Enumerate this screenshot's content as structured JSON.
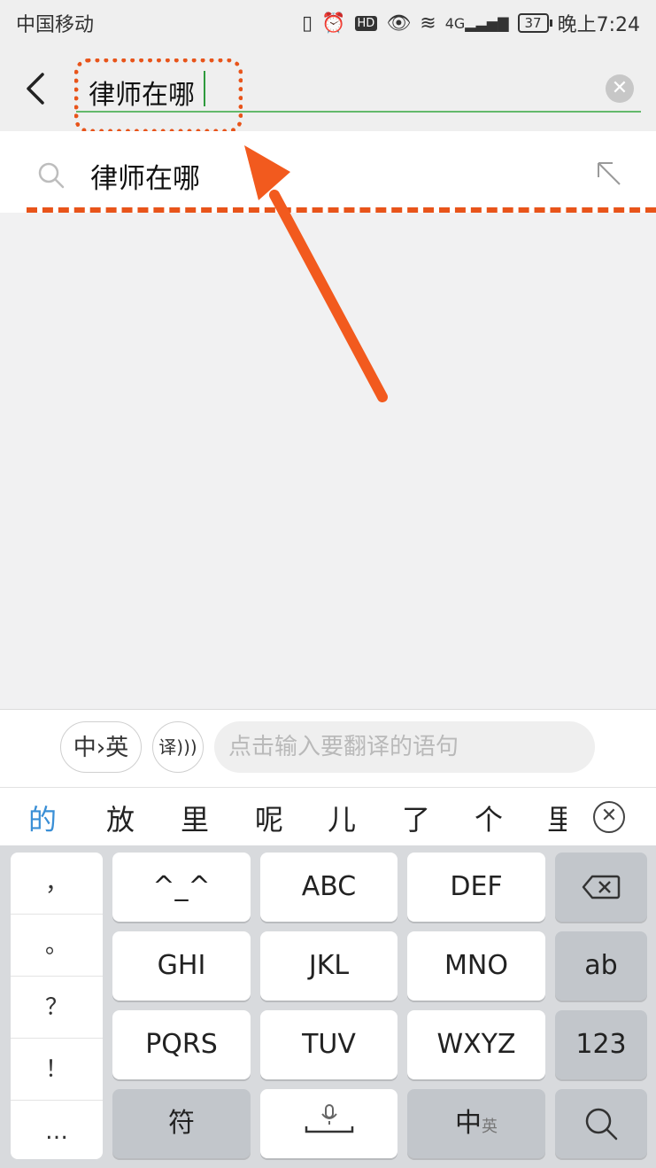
{
  "status_bar": {
    "carrier": "中国移动",
    "icons": [
      "vibrate-icon",
      "alarm-icon",
      "hd-icon",
      "eye-icon",
      "wifi-icon",
      "signal-4g-icon"
    ],
    "hd_label": "HD",
    "network_label": "4G",
    "battery": "37",
    "time": "晚上7:24"
  },
  "search": {
    "query": "律师在哪",
    "clear_icon": "clear-circle-icon",
    "back_icon": "back-chevron-icon"
  },
  "suggestions": [
    {
      "text": "律师在哪",
      "icon": "search-icon",
      "action_icon": "fill-arrow-icon"
    }
  ],
  "translate": {
    "toggle_label": "中›英",
    "icon_label": "译",
    "placeholder": "点击输入要翻译的语句"
  },
  "candidates": [
    "的",
    "放",
    "里",
    "呢",
    "儿",
    "了",
    "个",
    "里"
  ],
  "candidate_highlight_color": "#3a8fd6",
  "keyboard": {
    "punctuation": [
      "，",
      "。",
      "？",
      "！",
      "…"
    ],
    "rows": [
      [
        "^_^",
        "ABC",
        "DEF"
      ],
      [
        "GHI",
        "JKL",
        "MNO"
      ],
      [
        "PQRS",
        "TUV",
        "WXYZ"
      ]
    ],
    "right_keys": [
      "backspace",
      "ab",
      "123",
      "search"
    ],
    "bottom": {
      "symbol": "符",
      "lang": "中",
      "lang_small": "英"
    }
  },
  "colors": {
    "accent_green": "#2e9a3c",
    "annotation_orange": "#e8541a"
  }
}
